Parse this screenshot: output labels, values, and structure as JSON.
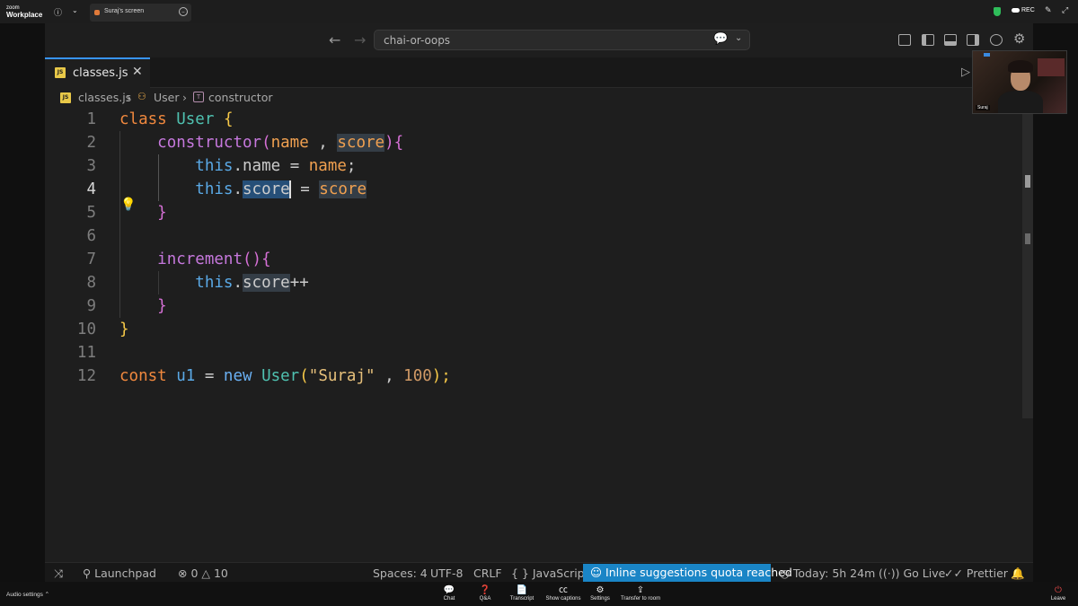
{
  "zoom": {
    "logo_line1": "zoom",
    "logo_line2": "Workplace",
    "tab_title": "Suraj's screen",
    "rec_label": "REC",
    "webcam_name": "Suraj",
    "bottom": {
      "audio_settings": "Audio settings",
      "chat": "Chat",
      "qa": "Q&A",
      "transcript": "Transcript",
      "captions": "Show captions",
      "settings": "Settings",
      "transfer": "Transfer to room",
      "leave": "Leave"
    }
  },
  "vscode": {
    "command_center": "chai-or-oops",
    "tab_label": "classes.js",
    "breadcrumb": {
      "file": "classes.js",
      "class": "User",
      "method": "constructor"
    },
    "editor": {
      "line_numbers": [
        "1",
        "2",
        "3",
        "4",
        "5",
        "6",
        "7",
        "8",
        "9",
        "10",
        "11",
        "12"
      ],
      "tokens": {
        "class_kw": "class",
        "class_name": "User",
        "ctor": "constructor",
        "p_name": "name",
        "comma": " , ",
        "p_score": "score",
        "this_kw": "this",
        "dot": ".",
        "name_prop": "name",
        "assign": " = ",
        "name_val": "name",
        "semi": ";",
        "score_prop": "score",
        "score_val": "score",
        "increment": "increment",
        "plusplus": "++",
        "const_kw": "const",
        "u1": "u1",
        "new_kw": "new",
        "ctor_class": "User",
        "str_arg": "\"Suraj\"",
        "num_arg": "100",
        "open_brace": "{",
        "close_brace": "}",
        "open_paren": "(",
        "close_paren": ")",
        "parens": "()",
        "close_stmt": ");"
      }
    },
    "status": {
      "launchpad": "Launchpad",
      "errors": "0",
      "warnings": "10",
      "spaces": "Spaces: 4",
      "encoding": "UTF-8",
      "eol": "CRLF",
      "language": "JavaScript",
      "quota": "Inline suggestions quota reached",
      "time": "Today: 5h 24m",
      "go_live": "Go Live",
      "prettier": "Prettier"
    }
  },
  "colors": {
    "status_highlight": "#1a85c6",
    "selection": "#264f78",
    "keyword": "#f0883e",
    "class_name": "#4fc1b0",
    "function": "#c678dd"
  }
}
